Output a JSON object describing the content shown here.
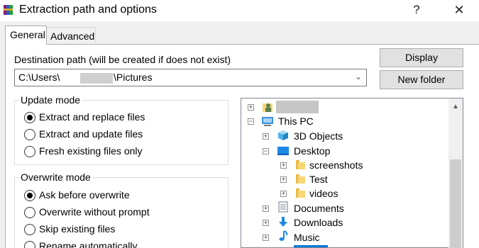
{
  "window": {
    "title": "Extraction path and options",
    "help_label": "?",
    "close_label": "✕"
  },
  "tabs": [
    {
      "label": "General"
    },
    {
      "label": "Advanced"
    }
  ],
  "destination": {
    "label": "Destination path (will be created if does not exist)",
    "value_prefix": "C:\\Users\\",
    "value_suffix": "\\Pictures"
  },
  "buttons": {
    "display": "Display",
    "new_folder": "New folder"
  },
  "update_mode": {
    "caption": "Update mode",
    "options": [
      {
        "label": "Extract and replace files",
        "selected": true
      },
      {
        "label": "Extract and update files",
        "selected": false
      },
      {
        "label": "Fresh existing files only",
        "selected": false
      }
    ]
  },
  "overwrite_mode": {
    "caption": "Overwrite mode",
    "options": [
      {
        "label": "Ask before overwrite",
        "selected": true
      },
      {
        "label": "Overwrite without prompt",
        "selected": false
      },
      {
        "label": "Skip existing files",
        "selected": false
      },
      {
        "label": "Rename automatically",
        "selected": false
      }
    ]
  },
  "tree": {
    "items": [
      {
        "label": "",
        "icon": "user-icon"
      },
      {
        "label": "This PC",
        "icon": "pc-icon"
      },
      {
        "label": "3D Objects",
        "icon": "3d-objects-icon"
      },
      {
        "label": "Desktop",
        "icon": "desktop-icon"
      },
      {
        "label": "screenshots",
        "icon": "folder-icon"
      },
      {
        "label": "Test",
        "icon": "folder-icon"
      },
      {
        "label": "videos",
        "icon": "folder-icon"
      },
      {
        "label": "Documents",
        "icon": "documents-icon"
      },
      {
        "label": "Downloads",
        "icon": "downloads-icon"
      },
      {
        "label": "Music",
        "icon": "music-icon"
      }
    ]
  },
  "colors": {
    "accent": "#0078d7",
    "folder": "#f8d775"
  }
}
